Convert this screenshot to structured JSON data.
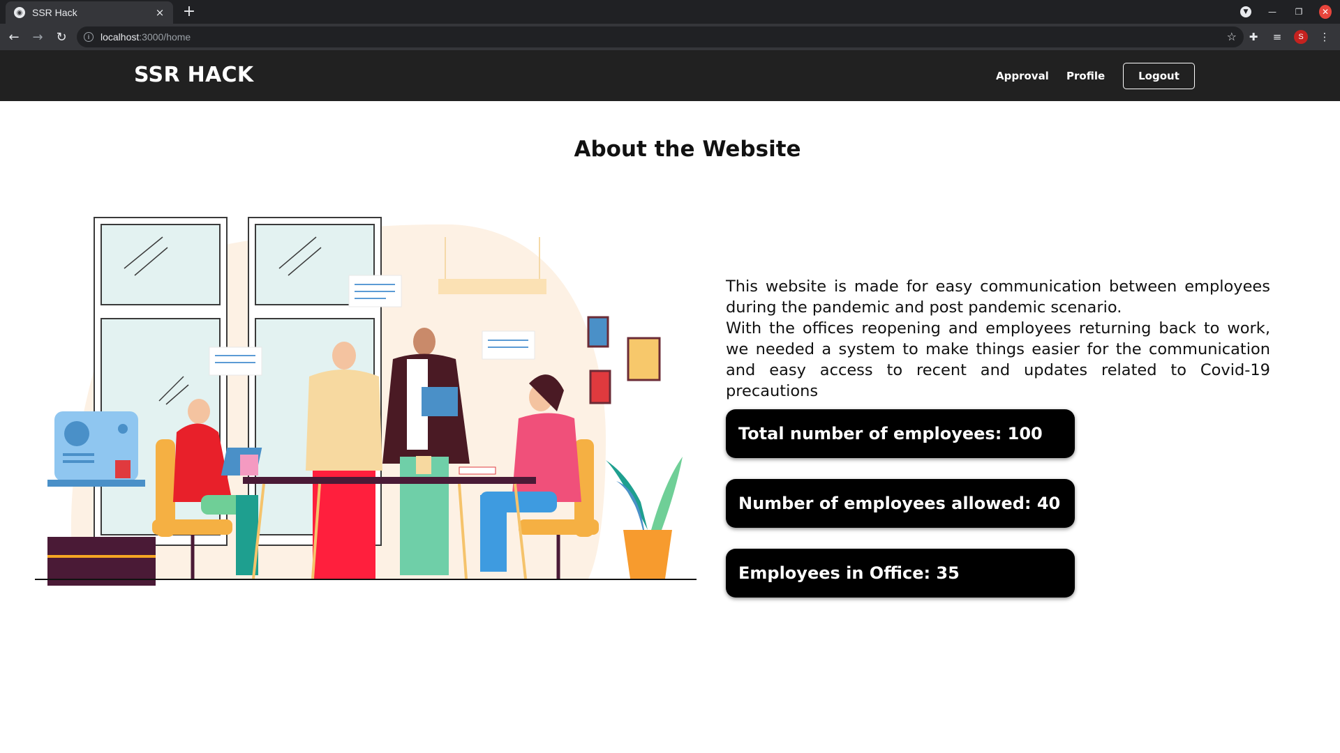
{
  "browser": {
    "tab_title": "SSR Hack",
    "tab_close": "×",
    "new_tab": "+",
    "url_host": "localhost",
    "url_rest": ":3000/home",
    "avatar_letter": "S"
  },
  "nav": {
    "brand": "SSR HACK",
    "links": [
      "Approval",
      "Profile"
    ],
    "logout": "Logout"
  },
  "main": {
    "title": "About the Website",
    "about": [
      "This website is made for easy communication between employees during the pandemic and post pandemic scenario.",
      "With the offices reopening and employees returning back to work, we needed a system to make things easier for the communication and easy access to recent and updates related to Covid-19 precautions"
    ],
    "stats": [
      "Total number of employees: 100",
      "Number of employees allowed: 40",
      "Employees in Office: 35"
    ]
  },
  "colors": {
    "nav_bg": "#212121",
    "card_bg": "#000000",
    "illustration_blob": "#fdf1e4"
  },
  "icons": [
    "globe-icon",
    "close-icon",
    "plus-icon",
    "back-icon",
    "forward-icon",
    "reload-icon",
    "info-icon",
    "star-icon",
    "extensions-icon",
    "reading-list-icon",
    "menu-icon",
    "minimize-icon",
    "restore-icon"
  ]
}
